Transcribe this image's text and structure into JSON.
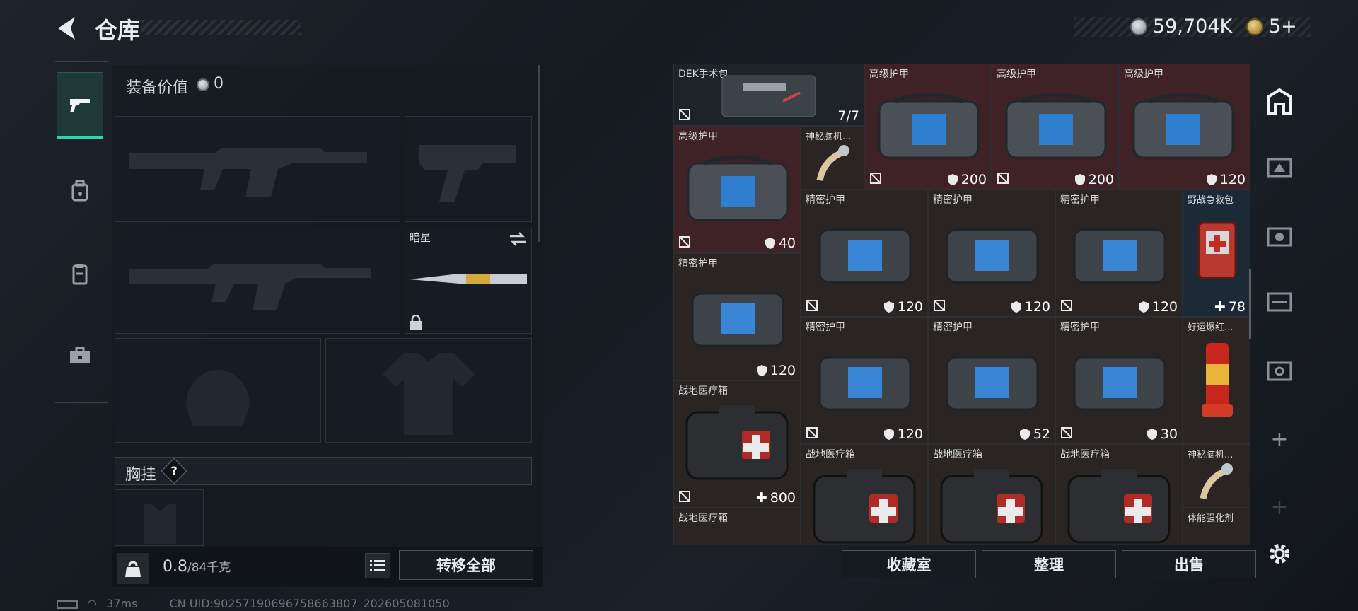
{
  "header": {
    "title": "仓库",
    "silver_amount": "59,704K",
    "gold_amount": "5+"
  },
  "left_tabs": [
    {
      "name": "weapons-tab",
      "active": true
    },
    {
      "name": "backpack-tab",
      "active": false
    },
    {
      "name": "clipboard-tab",
      "active": false
    },
    {
      "name": "toolbox-tab",
      "active": false
    }
  ],
  "loadout": {
    "equip_value_label": "装备价值",
    "equip_value": "0",
    "melee_name": "暗星",
    "chest_rig_label": "胸挂",
    "chest_rig_help": "?",
    "weight_value": "0.8",
    "weight_max": "/84千克",
    "transfer_all": "转移全部"
  },
  "grid_items": [
    {
      "name": "DEK手术包",
      "value": "7/7"
    },
    {
      "name": "高级护甲",
      "value": "200"
    },
    {
      "name": "高级护甲",
      "value": "200"
    },
    {
      "name": "高级护甲",
      "value": "120"
    },
    {
      "name": "高级护甲",
      "value": "40"
    },
    {
      "name": "神秘脑机...",
      "value": ""
    },
    {
      "name": "精密护甲",
      "value": "120"
    },
    {
      "name": "精密护甲",
      "value": "120"
    },
    {
      "name": "精密护甲",
      "value": "120"
    },
    {
      "name": "野战急救包",
      "value": "78"
    },
    {
      "name": "精密护甲",
      "value": "120"
    },
    {
      "name": "精密护甲",
      "value": "120"
    },
    {
      "name": "精密护甲",
      "value": "52"
    },
    {
      "name": "精密护甲",
      "value": "30"
    },
    {
      "name": "好运爆红...",
      "value": ""
    },
    {
      "name": "战地医疗箱",
      "value": "800"
    },
    {
      "name": "战地医疗箱",
      "value": ""
    },
    {
      "name": "战地医疗箱",
      "value": ""
    },
    {
      "name": "战地医疗箱",
      "value": ""
    },
    {
      "name": "神秘脑机...",
      "value": ""
    },
    {
      "name": "战地医疗箱",
      "value": ""
    },
    {
      "name": "体能强化剂",
      "value": ""
    }
  ],
  "actions": {
    "collection": "收藏室",
    "organize": "整理",
    "sell": "出售"
  },
  "status": {
    "ping": "37ms",
    "uid": "CN UID:9025719069675866380​7_202605081050"
  }
}
